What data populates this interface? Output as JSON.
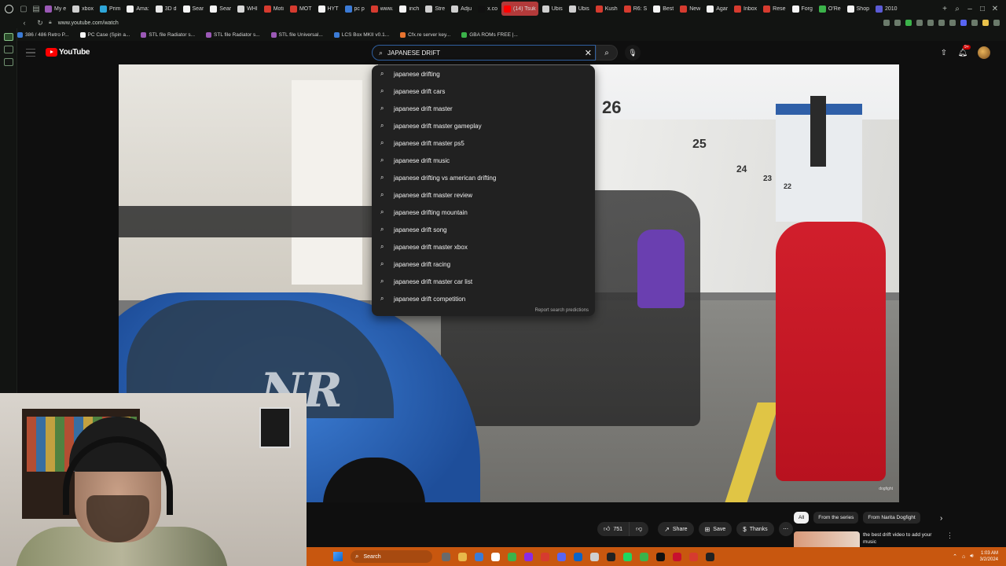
{
  "browser": {
    "tabs": [
      {
        "label": "My e",
        "color": "#9b59b6"
      },
      {
        "label": "xbox",
        "color": "#cfcfcf"
      },
      {
        "label": "Prim",
        "color": "#2ea6d9"
      },
      {
        "label": "Ama:",
        "color": "#f5f5f5"
      },
      {
        "label": "3D d",
        "color": "#e8e8e8"
      },
      {
        "label": "Sear",
        "color": "#f5f5f5"
      },
      {
        "label": "Sear",
        "color": "#f5f5f5"
      },
      {
        "label": "WHI",
        "color": "#d8d8d8"
      },
      {
        "label": "Moti",
        "color": "#d63b2f"
      },
      {
        "label": "MOT",
        "color": "#d63b2f"
      },
      {
        "label": "HYT",
        "color": "#f5f5f5"
      },
      {
        "label": "pc p",
        "color": "#3b7bd6"
      },
      {
        "label": "www.",
        "color": "#d63b2f"
      },
      {
        "label": "inch",
        "color": "#f5f5f5"
      },
      {
        "label": "Stre",
        "color": "#cfcfcf"
      },
      {
        "label": "Adju",
        "color": "#cfcfcf"
      },
      {
        "label": "x.co",
        "color": "#111111"
      },
      {
        "label": "(14) Tsuk",
        "color": "#ff0000",
        "active": true
      },
      {
        "label": "Ubis",
        "color": "#cfcfcf"
      },
      {
        "label": "Ubis",
        "color": "#cfcfcf"
      },
      {
        "label": "Kush",
        "color": "#d63b2f"
      },
      {
        "label": "R6: S",
        "color": "#d63b2f"
      },
      {
        "label": "Best",
        "color": "#f5f5f5"
      },
      {
        "label": "New",
        "color": "#d63b2f"
      },
      {
        "label": "Agar",
        "color": "#f5f5f5"
      },
      {
        "label": "Inbox",
        "color": "#d63b2f"
      },
      {
        "label": "Rese",
        "color": "#d63b2f"
      },
      {
        "label": "Forg",
        "color": "#f5f5f5"
      },
      {
        "label": "O'Re",
        "color": "#3bb34a"
      },
      {
        "label": "Shop",
        "color": "#f5f5f5"
      },
      {
        "label": "2010",
        "color": "#5b5bd6"
      }
    ],
    "url": "www.youtube.com/watch",
    "bookmarks": [
      {
        "label": "386 / 486 Retro P...",
        "color": "#3b7bd6"
      },
      {
        "label": "PC Case (Spin a...",
        "color": "#f5f5f5"
      },
      {
        "label": "STL file Radiator s...",
        "color": "#9b59b6"
      },
      {
        "label": "STL file Radiator s...",
        "color": "#9b59b6"
      },
      {
        "label": "STL file Universal...",
        "color": "#9b59b6"
      },
      {
        "label": "LCS Box MKII v0.1...",
        "color": "#3b7bd6"
      },
      {
        "label": "Cfx.re server key...",
        "color": "#e8742f"
      },
      {
        "label": "GBA ROMs FREE |...",
        "color": "#3bb34a"
      }
    ]
  },
  "youtube": {
    "logo_text": "YouTube",
    "search": {
      "value": "JAPANESE DRIFT",
      "placeholder": "Search"
    },
    "notifications_badge": "9+",
    "suggestions": [
      "japanese drifting",
      "japanese drift cars",
      "japanese drift master",
      "japanese drift master gameplay",
      "japanese drift master ps5",
      "japanese drift music",
      "japanese drifting vs american drifting",
      "japanese drift master review",
      "japanese drifting mountain",
      "japanese drift song",
      "japanese drift master xbox",
      "japanese drift racing",
      "japanese drift master car list",
      "japanese drift competition"
    ],
    "report_text": "Report search predictions",
    "video": {
      "pit_numbers": [
        "26",
        "25",
        "24",
        "23",
        "22"
      ],
      "car_decal": "NR",
      "watermark": "dogfight"
    },
    "actions": {
      "like_count": "751",
      "share": "Share",
      "save": "Save",
      "thanks": "Thanks"
    },
    "chips": [
      "All",
      "From the series",
      "From Narita Dogfight"
    ],
    "recommended": {
      "title": "the best drift video to add your music"
    }
  },
  "taskbar": {
    "search_label": "Search",
    "time": "1:03 AM",
    "date": "3/2/2024",
    "apps": [
      "#6a6a6a",
      "#e8b84a",
      "#3b7bd6",
      "#ffffff",
      "#3bb34a",
      "#8a2be2",
      "#d63b2f",
      "#5865f2",
      "#0a64c8",
      "#cfcfcf",
      "#222222",
      "#1ed760",
      "#3bb34a",
      "#111111",
      "#c8102e",
      "#d63b2f",
      "#222222"
    ]
  }
}
